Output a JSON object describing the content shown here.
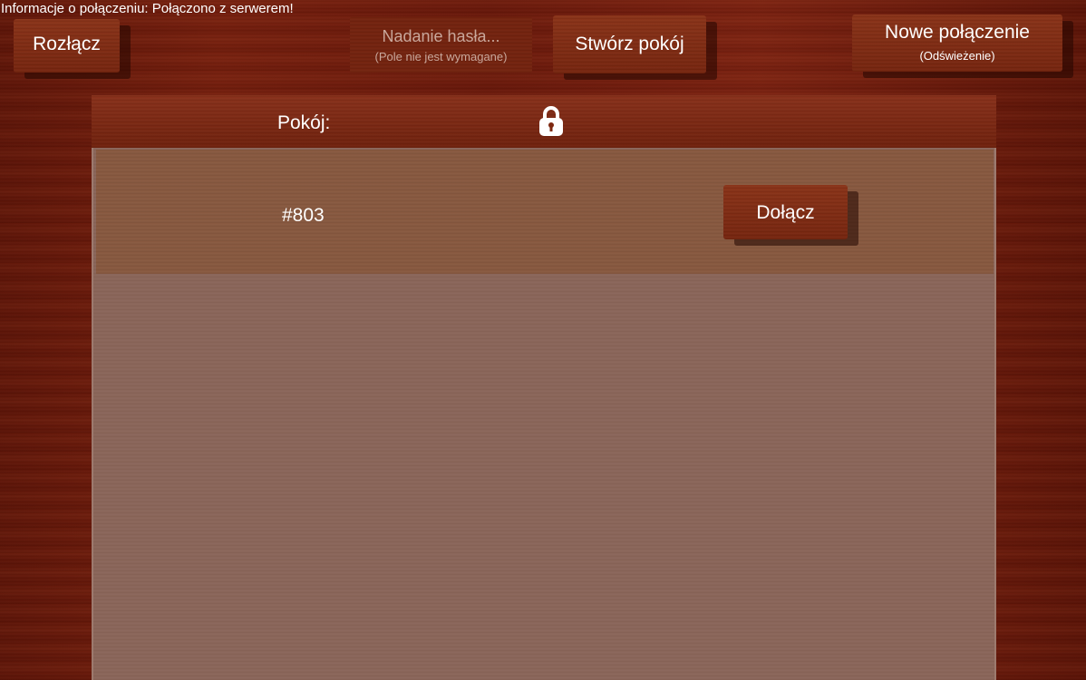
{
  "status": {
    "connection_info": "Informacje o połączeniu: Połączono z serwerem!"
  },
  "toolbar": {
    "disconnect_label": "Rozłącz",
    "password": {
      "placeholder": "Nadanie hasła...",
      "hint": "(Pole nie jest wymagane)",
      "value": ""
    },
    "create_room_label": "Stwórz pokój",
    "new_connection_label": "Nowe połączenie",
    "new_connection_sub": "(Odświeżenie)"
  },
  "room_list": {
    "header_room_label": "Pokój:",
    "header_lock_icon": "lock-icon",
    "rooms": [
      {
        "name": "#803",
        "join_label": "Dołącz"
      }
    ]
  },
  "colors": {
    "background": "#6b1a0c",
    "button": "#7e2a13",
    "list_background": "#8a6559",
    "row_background": "#87583f",
    "text": "#ffffff",
    "placeholder_text": "#c9a79b"
  }
}
